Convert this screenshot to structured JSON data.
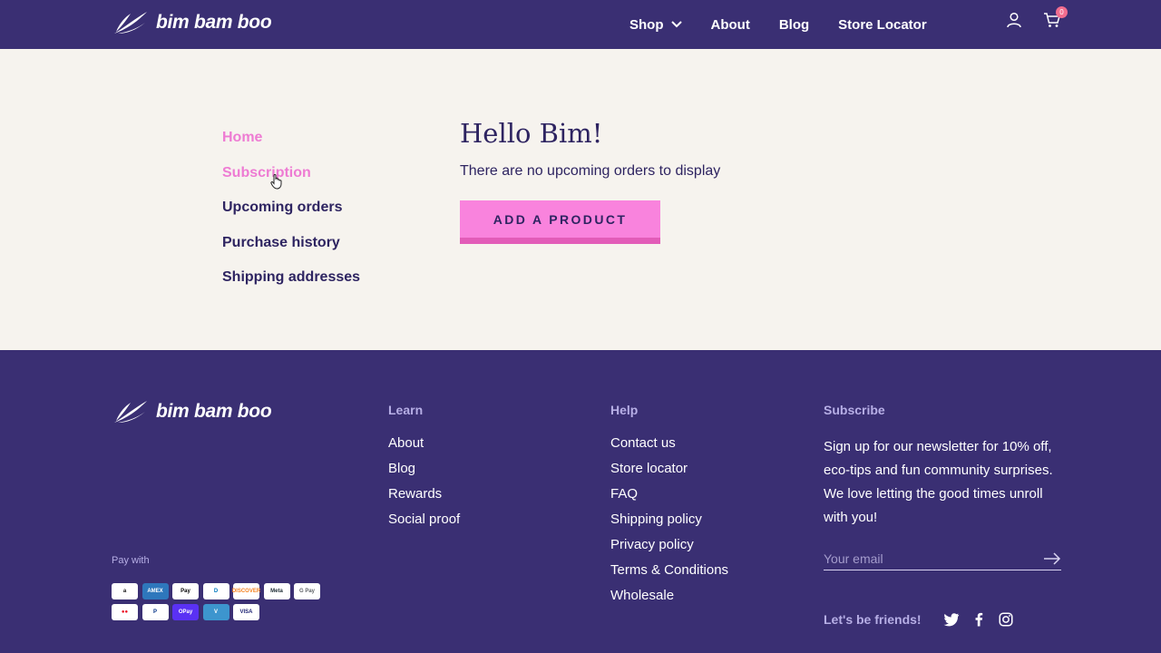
{
  "brand": {
    "name": "bim bam boo"
  },
  "header": {
    "nav": [
      {
        "label": "Shop",
        "has_dropdown": true
      },
      {
        "label": "About"
      },
      {
        "label": "Blog"
      },
      {
        "label": "Store Locator"
      }
    ],
    "cart_count": "0"
  },
  "account": {
    "menu": [
      {
        "label": "Home",
        "active": true
      },
      {
        "label": "Subscription",
        "active": true
      },
      {
        "label": "Upcoming orders"
      },
      {
        "label": "Purchase history"
      },
      {
        "label": "Shipping addresses"
      }
    ],
    "greeting": "Hello Bim!",
    "message": "There are no upcoming orders to display",
    "add_button": "ADD A PRODUCT"
  },
  "footer": {
    "learn": {
      "heading": "Learn",
      "links": [
        "About",
        "Blog",
        "Rewards",
        "Social proof"
      ]
    },
    "help": {
      "heading": "Help",
      "links": [
        "Contact us",
        "Store locator",
        "FAQ",
        "Shipping policy",
        "Privacy policy",
        "Terms & Conditions",
        "Wholesale"
      ]
    },
    "subscribe": {
      "heading": "Subscribe",
      "text": "Sign up for our newsletter for 10% off, eco-tips and fun community surprises. We love letting the good times unroll with you!",
      "email_placeholder": "Your email",
      "friends_label": "Let's be friends!"
    },
    "pay_with": "Pay with",
    "payment_methods": [
      {
        "name": "amazon-pay",
        "label": "a",
        "bg": "#ffffff",
        "fg": "#111111"
      },
      {
        "name": "american-express",
        "label": "AMEX",
        "bg": "#2e77bc",
        "fg": "#ffffff"
      },
      {
        "name": "apple-pay",
        "label": " Pay",
        "bg": "#ffffff",
        "fg": "#000000"
      },
      {
        "name": "diners-club",
        "label": "D",
        "bg": "#ffffff",
        "fg": "#0079be"
      },
      {
        "name": "discover",
        "label": "DISCOVER",
        "bg": "#ffffff",
        "fg": "#f58220"
      },
      {
        "name": "meta-pay",
        "label": "Meta",
        "bg": "#ffffff",
        "fg": "#1c2b33"
      },
      {
        "name": "google-pay",
        "label": "G Pay",
        "bg": "#ffffff",
        "fg": "#5f6368"
      },
      {
        "name": "mastercard",
        "label": "●●",
        "bg": "#ffffff",
        "fg": "#eb001b"
      },
      {
        "name": "paypal",
        "label": "P",
        "bg": "#ffffff",
        "fg": "#003087"
      },
      {
        "name": "shop-pay",
        "label": "OPay",
        "bg": "#5a31f4",
        "fg": "#ffffff"
      },
      {
        "name": "venmo",
        "label": "V",
        "bg": "#3d95ce",
        "fg": "#ffffff"
      },
      {
        "name": "visa",
        "label": "VISA",
        "bg": "#ffffff",
        "fg": "#1a1f71"
      }
    ]
  },
  "colors": {
    "brand_purple": "#3a2f73",
    "accent_pink": "#f983dd",
    "active_link": "#ee7bd3",
    "background": "#f6f3ee"
  }
}
